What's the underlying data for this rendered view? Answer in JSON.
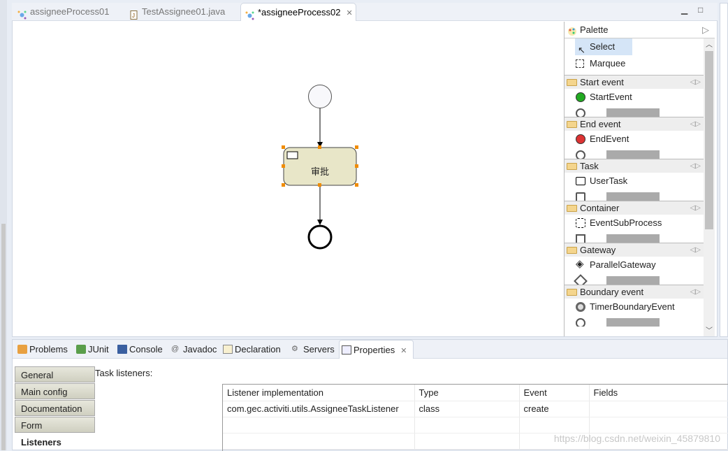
{
  "editor_tabs": [
    {
      "label": "assigneeProcess01",
      "icon": "process-icon",
      "active": false
    },
    {
      "label": "TestAssignee01.java",
      "icon": "java-file-icon",
      "active": false
    },
    {
      "label": "*assigneeProcess02",
      "icon": "process-icon",
      "active": true
    }
  ],
  "diagram": {
    "task_label": "审批"
  },
  "palette": {
    "title": "Palette",
    "tools": [
      {
        "label": "Select",
        "icon": "arrow-cursor-icon"
      },
      {
        "label": "Marquee",
        "icon": "marquee-icon"
      }
    ],
    "drawers": [
      {
        "label": "Start event",
        "item": "StartEvent",
        "icon": "start-event-icon"
      },
      {
        "label": "End event",
        "item": "EndEvent",
        "icon": "end-event-icon"
      },
      {
        "label": "Task",
        "item": "UserTask",
        "icon": "user-task-icon"
      },
      {
        "label": "Container",
        "item": "EventSubProcess",
        "icon": "subprocess-icon"
      },
      {
        "label": "Gateway",
        "item": "ParallelGateway",
        "icon": "parallel-gateway-icon"
      },
      {
        "label": "Boundary event",
        "item": "TimerBoundaryEvent",
        "icon": "timer-icon"
      }
    ]
  },
  "bottom_tabs": [
    {
      "label": "Problems"
    },
    {
      "label": "JUnit"
    },
    {
      "label": "Console"
    },
    {
      "label": "Javadoc"
    },
    {
      "label": "Declaration"
    },
    {
      "label": "Servers"
    },
    {
      "label": "Properties",
      "active": true
    }
  ],
  "properties": {
    "side_tabs": [
      "General",
      "Main config",
      "Documentation",
      "Form",
      "Listeners"
    ],
    "active_side_tab": "Listeners",
    "section_label": "Task listeners:",
    "columns": [
      "Listener implementation",
      "Type",
      "Event",
      "Fields"
    ],
    "rows": [
      [
        "com.gec.activiti.utils.AssigneeTaskListener",
        "class",
        "create",
        ""
      ]
    ]
  },
  "watermark": "https://blog.csdn.net/weixin_45879810",
  "colors": {
    "task_fill": "#e8e6c8",
    "selection_handle": "#f08c00",
    "start_green": "#22aa22",
    "end_red": "#dd3333"
  }
}
